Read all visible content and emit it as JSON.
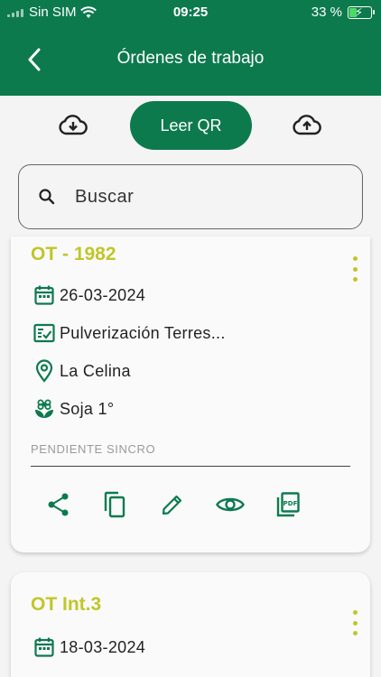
{
  "status_bar": {
    "carrier": "Sin SIM",
    "time": "09:25",
    "battery": "33 %"
  },
  "header": {
    "title": "Órdenes de trabajo"
  },
  "toolbar": {
    "qr_label": "Leer QR"
  },
  "search": {
    "placeholder": "Buscar"
  },
  "colors": {
    "primary": "#0d7a4e",
    "accent": "#c0c62a"
  },
  "orders": [
    {
      "title": "OT - 1982",
      "date": "26-03-2024",
      "task": "Pulverización Terres...",
      "location": "La Celina",
      "crop": "Soja 1°",
      "status": "PENDIENTE SINCRO"
    },
    {
      "title": "OT Int.3",
      "date": "18-03-2024"
    }
  ]
}
